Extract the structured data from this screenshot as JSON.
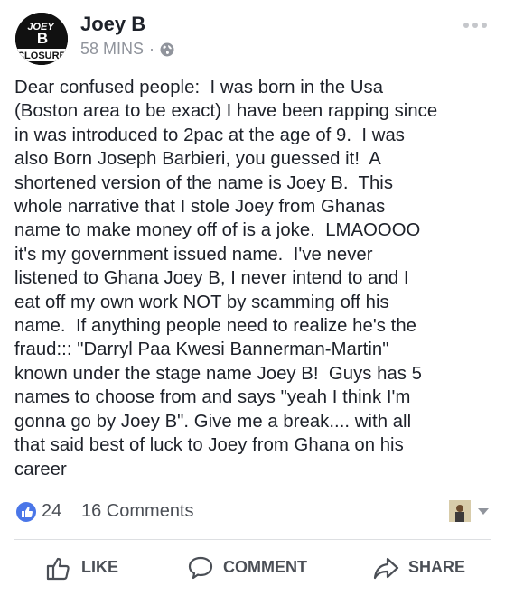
{
  "post": {
    "author": "Joey B",
    "avatar_text": {
      "top": "JOEY",
      "middle": "B",
      "bottom": "CLOSURE"
    },
    "time": "58 MINS",
    "separator": "·",
    "privacy_icon": "globe-icon",
    "more_icon": "more-dots-icon",
    "text": "Dear confused people:  I was born in the Usa\n(Boston area to be exact) I have been rapping since\nin was introduced to 2pac at the age of 9.  I was\nalso Born Joseph Barbieri, you guessed it!  A\nshortened version of the name is Joey B.  This\nwhole narrative that I stole Joey from Ghanas\nname to make money off of is a joke.  LMAOOOO\nit's my government issued name.  I've never\nlistened to Ghana Joey B, I never intend to and I\neat off my own work NOT by scamming off his\nname.  If anything people need to realize he's the\nfraud::: \"Darryl Paa Kwesi Bannerman-Martin\"\nknown under the stage name Joey B!  Guys has 5\nnames to choose from and says \"yeah I think I'm\ngonna go by Joey B\". Give me a break.... with all\nthat said best of luck to Joey from Ghana on his\ncareer"
  },
  "stats": {
    "likes": "24",
    "comments": "16 Comments",
    "like_icon": "like-badge-icon",
    "colors": {
      "like_badge": "#4a76e8",
      "muted_text": "#4b4f56"
    }
  },
  "actions": {
    "like": "LIKE",
    "comment": "COMMENT",
    "share": "SHARE"
  }
}
